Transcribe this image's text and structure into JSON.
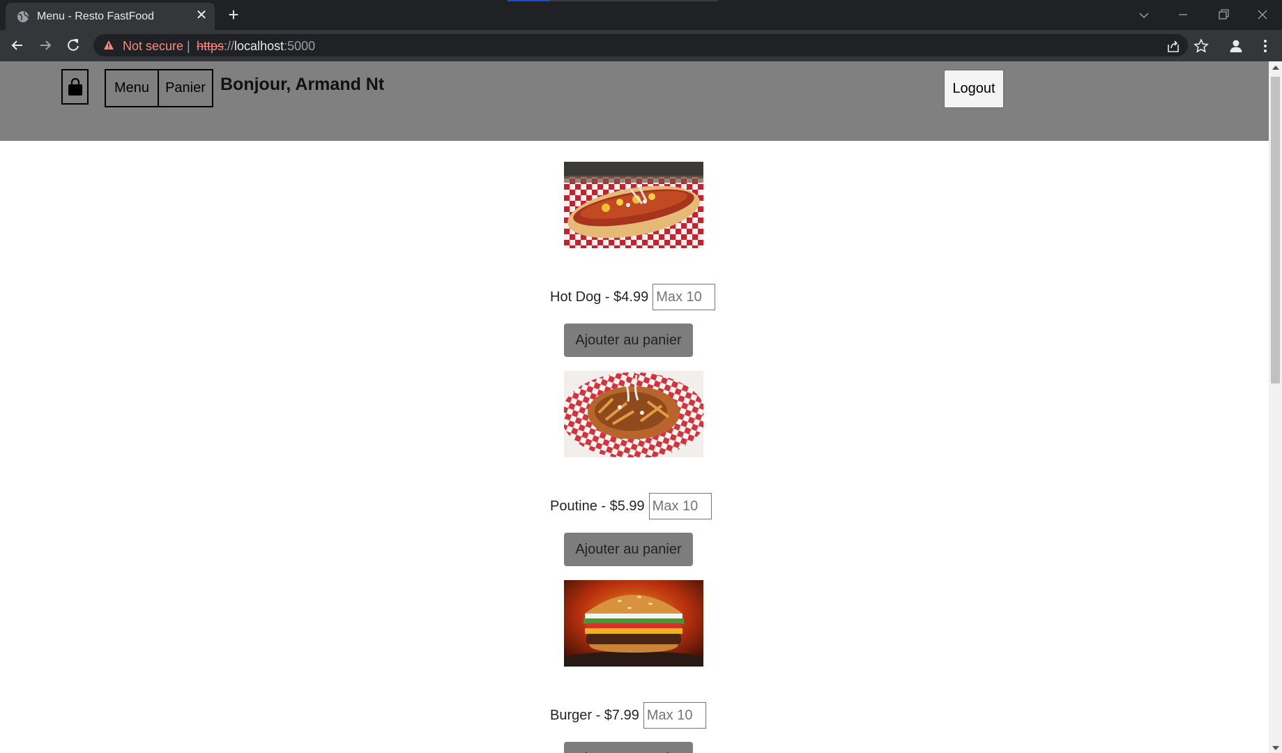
{
  "browser": {
    "tab_title": "Menu - Resto FastFood",
    "security_label": "Not secure",
    "url_protocol": "https",
    "url_separator": "://",
    "url_host": "localhost",
    "url_port": ":5000"
  },
  "header": {
    "menu_label": "Menu",
    "cart_label": "Panier",
    "greeting": "Bonjour, Armand Nt",
    "logout_label": "Logout"
  },
  "products": [
    {
      "name_price": "Hot Dog - $4.99",
      "qty_placeholder": "Max 10",
      "add_label": "Ajouter au panier",
      "image_icon": "hot-dog-photo"
    },
    {
      "name_price": "Poutine - $5.99",
      "qty_placeholder": "Max 10",
      "add_label": "Ajouter au panier",
      "image_icon": "poutine-photo"
    },
    {
      "name_price": "Burger - $7.99",
      "qty_placeholder": "Max 10",
      "add_label": "Ajouter au panier",
      "image_icon": "burger-photo"
    }
  ],
  "colors": {
    "header_bg": "#808080",
    "button_bg": "#7d7d7d",
    "browser_frame": "#202124"
  }
}
